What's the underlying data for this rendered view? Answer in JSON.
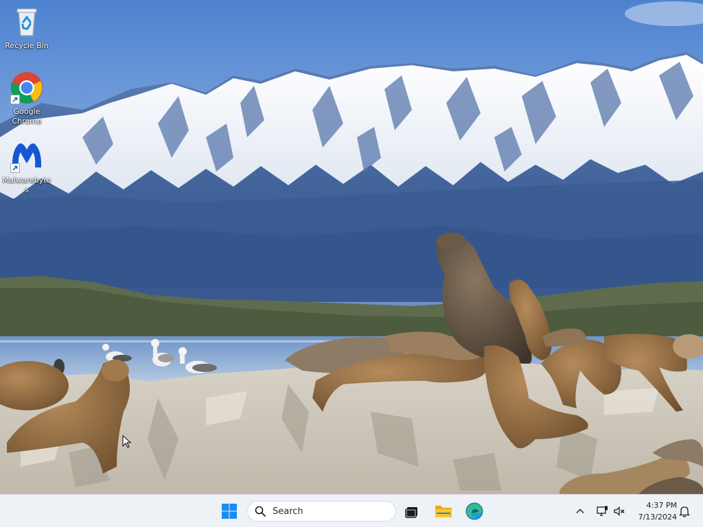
{
  "desktop": {
    "icons": [
      {
        "label": "Recycle Bin",
        "icon": "recycle-bin-icon"
      },
      {
        "label": "Google Chrome",
        "icon": "chrome-icon"
      },
      {
        "label": "Malwarebytes",
        "icon": "malwarebytes-icon"
      }
    ],
    "wallpaper": "snow-capped mountains with sea lions and gulls on rocks"
  },
  "taskbar": {
    "start_icon": "windows-start-icon",
    "search_placeholder": "Search",
    "pinned": [
      {
        "name": "task-view",
        "icon": "task-view-icon"
      },
      {
        "name": "file-explorer",
        "icon": "folder-icon"
      },
      {
        "name": "microsoft-edge",
        "icon": "edge-icon"
      }
    ],
    "tray": {
      "overflow_icon": "chevron-up-icon",
      "network_icon": "network-icon",
      "volume_icon": "volume-muted-icon",
      "notification_icon": "bell-icon"
    },
    "clock": {
      "time": "4:37 PM",
      "date": "7/13/2024"
    }
  },
  "colors": {
    "taskbar_bg": "#eef1f6",
    "windows_blue": "#0a7ad8",
    "folder_yellow": "#f8c630"
  }
}
